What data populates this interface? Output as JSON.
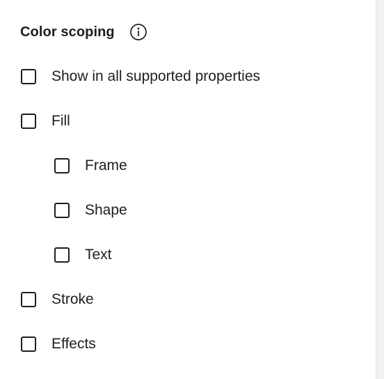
{
  "section": {
    "title": "Color scoping",
    "info_icon": "info-icon"
  },
  "options": [
    {
      "label": "Show in all supported properties",
      "checked": false
    },
    {
      "label": "Fill",
      "checked": false
    },
    {
      "label": "Frame",
      "checked": false
    },
    {
      "label": "Shape",
      "checked": false
    },
    {
      "label": "Text",
      "checked": false
    },
    {
      "label": "Stroke",
      "checked": false
    },
    {
      "label": "Effects",
      "checked": false
    }
  ]
}
